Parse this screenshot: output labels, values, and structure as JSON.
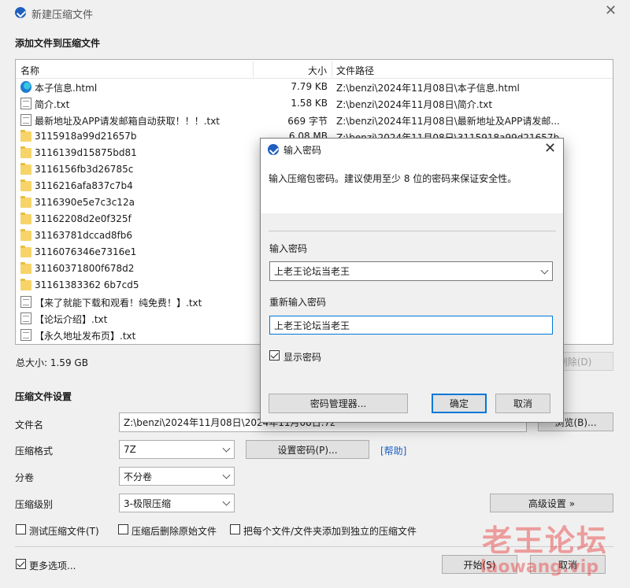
{
  "window": {
    "title": "新建压缩文件",
    "add_files_label": "添加文件到压缩文件"
  },
  "file_list": {
    "columns": {
      "name": "名称",
      "size": "大小",
      "path": "文件路径"
    },
    "rows": [
      {
        "name": "本子信息.html",
        "size": "7.79 KB",
        "path": "Z:\\benzi\\2024年11月08日\\本子信息.html",
        "icon": "edge-html-icon"
      },
      {
        "name": "简介.txt",
        "size": "1.58 KB",
        "path": "Z:\\benzi\\2024年11月08日\\简介.txt",
        "icon": "text-file-icon"
      },
      {
        "name": "最新地址及APP请发邮箱自动获取！！！.txt",
        "size": "669 字节",
        "path": "Z:\\benzi\\2024年11月08日\\最新地址及APP请发邮...",
        "icon": "text-file-icon"
      },
      {
        "name": "3115918a99d21657b",
        "size": "6.08 MB",
        "path": "Z:\\benzi\\2024年11月08日\\3115918a99d21657b",
        "icon": "folder-icon"
      },
      {
        "name": "3116139d15875bd81",
        "size": "",
        "path": "",
        "icon": "folder-icon"
      },
      {
        "name": "3116156fb3d26785c",
        "size": "",
        "path": "",
        "icon": "folder-icon"
      },
      {
        "name": "3116216afa837c7b4",
        "size": "",
        "path": "",
        "icon": "folder-icon"
      },
      {
        "name": "3116390e5e7c3c12a",
        "size": "",
        "path": "",
        "icon": "folder-icon"
      },
      {
        "name": "31162208d2e0f325f",
        "size": "",
        "path": "",
        "icon": "folder-icon"
      },
      {
        "name": "31163781dccad8fb6",
        "size": "",
        "path": "",
        "icon": "folder-icon"
      },
      {
        "name": "3116076346e7316e1",
        "size": "",
        "path": "",
        "icon": "folder-icon"
      },
      {
        "name": "31160371800f678d2",
        "size": "",
        "path": "",
        "icon": "folder-icon"
      },
      {
        "name": "31161383362 6b7cd5",
        "size": "",
        "path": "",
        "icon": "folder-icon"
      },
      {
        "name": "【来了就能下载和观看！纯免费！】.txt",
        "size": "",
        "path": "",
        "icon": "text-file-icon"
      },
      {
        "name": "【论坛介绍】.txt",
        "size": "",
        "path": "",
        "icon": "text-file-icon"
      },
      {
        "name": "【永久地址发布页】.txt",
        "size": "",
        "path": "",
        "icon": "text-file-icon"
      }
    ]
  },
  "total_size": "总大小: 1.59 GB",
  "delete_button": "删除(D)",
  "settings": {
    "section_title": "压缩文件设置",
    "filename_label": "文件名",
    "filename_value": "Z:\\benzi\\2024年11月08日\\2024年11月08日.7z",
    "browse_button": "浏览(B)...",
    "format_label": "压缩格式",
    "format_value": "7Z",
    "set_password_button": "设置密码(P)...",
    "help_link": "[帮助]",
    "volume_label": "分卷",
    "volume_value": "不分卷",
    "level_label": "压缩级别",
    "level_value": "3-极限压缩",
    "advanced_button": "高级设置 »",
    "test_checkbox": "测试压缩文件(T)",
    "delete_source_checkbox": "压缩后删除原始文件",
    "separate_checkbox": "把每个文件/文件夹添加到独立的压缩文件",
    "more_options_checkbox": "更多选项...",
    "start_button": "开始(S)",
    "cancel_button": "取消"
  },
  "password_dialog": {
    "title": "输入密码",
    "description": "输入压缩包密码。建议使用至少 8 位的密码来保证安全性。",
    "password_label": "输入密码",
    "password_value": "上老王论坛当老王",
    "reenter_label": "重新输入密码",
    "reenter_value": "上老王论坛当老王",
    "show_password": "显示密码",
    "manager_button": "密码管理器...",
    "ok_button": "确定",
    "cancel_button": "取消"
  },
  "watermark": {
    "text": "老王论坛",
    "url": "laowang.vip"
  },
  "colors": {
    "accent": "#0078d7",
    "folder": "#f6d46a",
    "help_link": "#1a5fc4",
    "watermark": "#e82828"
  }
}
